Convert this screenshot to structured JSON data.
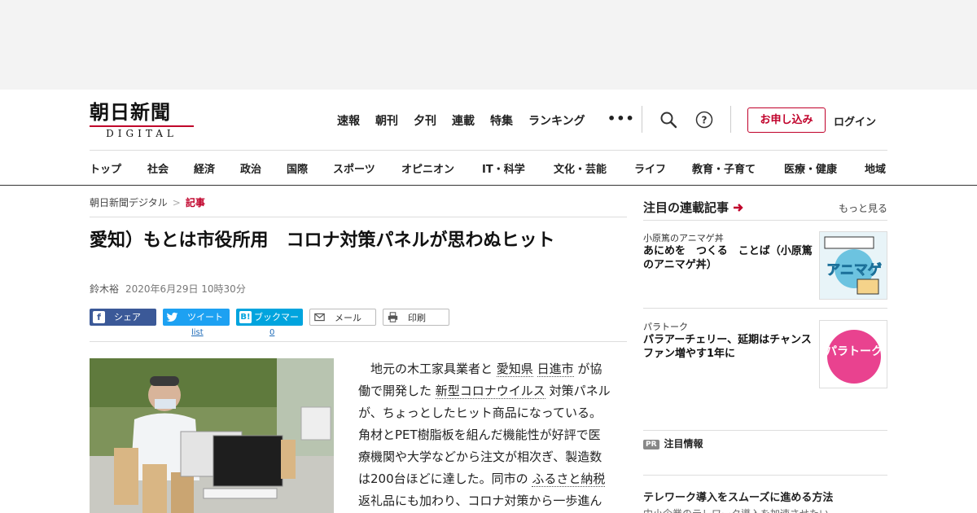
{
  "header": {
    "logo": {
      "main": "朝日新聞",
      "sub": "DIGITAL"
    },
    "topnav": [
      "速報",
      "朝刊",
      "夕刊",
      "連載",
      "特集",
      "ランキング"
    ],
    "more": "•••",
    "signup": "お申し込み",
    "login": "ログイン"
  },
  "categories": [
    "トップ",
    "社会",
    "経済",
    "政治",
    "国際",
    "スポーツ",
    "オピニオン",
    "IT・科学",
    "文化・芸能",
    "ライフ",
    "教育・子育て",
    "医療・健康",
    "地域"
  ],
  "breadcrumb": {
    "home": "朝日新聞デジタル",
    "sep": ">",
    "current": "記事"
  },
  "article": {
    "headline": "愛知）もとは市役所用　コロナ対策パネルが思わぬヒット",
    "author": "鈴木裕",
    "date": "2020年6月29日 10時30分",
    "share": {
      "facebook": "シェア",
      "twitter": "ツイート",
      "hatena": "ブックマーク",
      "mail": "メール",
      "print": "印刷",
      "twitter_count": "list",
      "hatena_count": "0"
    },
    "body": {
      "s1": "地元の木工家具業者と",
      "k1": "愛知県",
      "k2": "日進市",
      "s2": "が協働で開発した",
      "k3": "新型コロナウイルス",
      "s3": "対策パネルが、ちょっとしたヒット商品になっている。角材とPET樹脂板を組んだ機能性が好評で医療機関や大学などから注文が相次ぎ、製造数は200台ほどに達した。同市の",
      "k4": "ふるさと納税",
      "s4": "返礼品にも加わり、コロナ対策から一歩進んでビジネスチャンスに"
    }
  },
  "sidebar": {
    "title": "注目の連載記事",
    "more": "もっと見る",
    "items": [
      {
        "tag": "小原篤のアニマゲ丼",
        "title": "あにめを　つくる　ことば（小原篤のアニマゲ丼）",
        "thumb_text": "アニマゲ"
      },
      {
        "tag": "パラトーク",
        "title": "パラアーチェリー、延期はチャンス　ファン増やす1年に",
        "thumb_text": "パラトーク"
      }
    ],
    "pr": {
      "badge": "PR",
      "label": "注目情報",
      "title": "テレワーク導入をスムーズに進める方法",
      "sub": "中小企業のテレワーク導入を加速させたい"
    }
  },
  "colors": {
    "brand_red": "#c0002a",
    "facebook": "#3b5998",
    "twitter": "#1da1f2",
    "hatena": "#00a4de"
  }
}
